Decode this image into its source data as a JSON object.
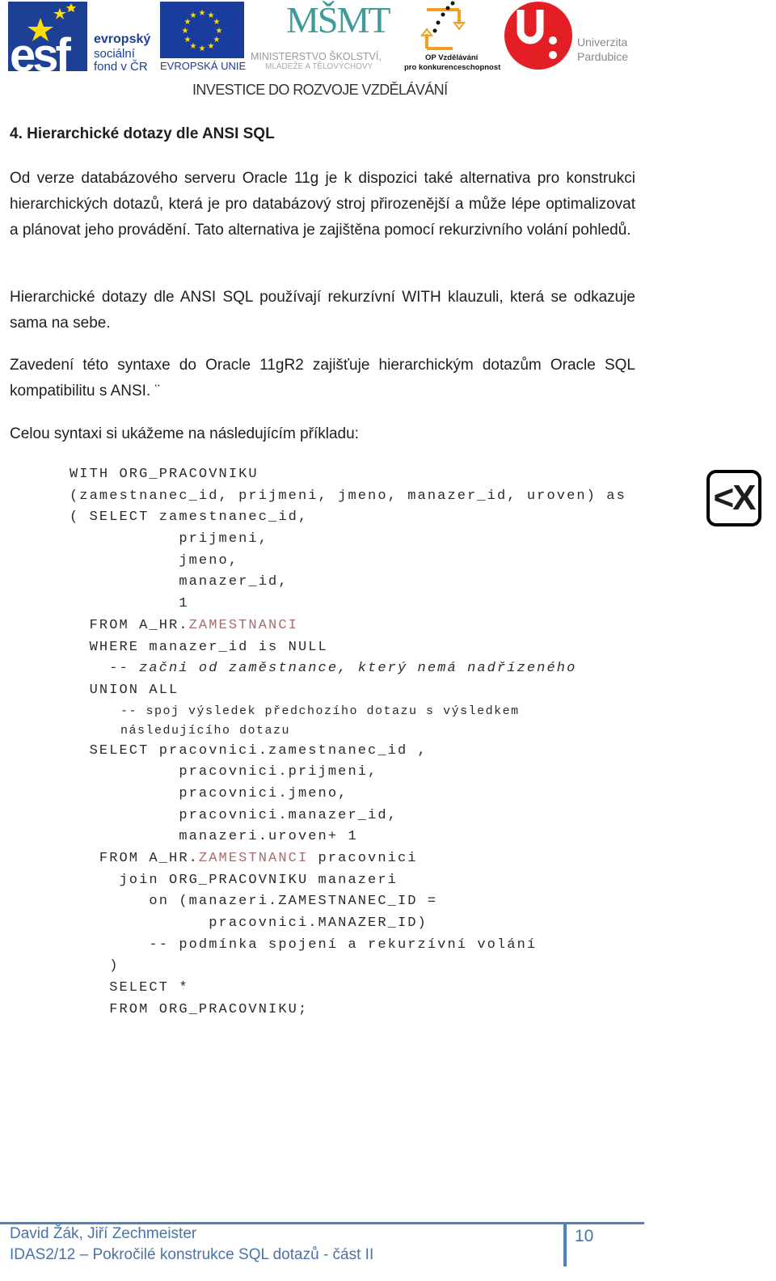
{
  "header": {
    "logos": {
      "esf": {
        "mark": "esf",
        "line1": "evropský",
        "line2": "sociální",
        "line3": "fond v ČR"
      },
      "eu": {
        "label": "EVROPSKÁ UNIE"
      },
      "msmt": {
        "mark": "MŠMT",
        "line1": "MINISTERSTVO ŠKOLSTVÍ,",
        "line2": "MLÁDEŽE A TĚLOVÝCHOVY"
      },
      "op": {
        "line1": "OP Vzdělávání",
        "line2": "pro konkurenceschopnost"
      },
      "upce": {
        "line1": "Univerzita",
        "line2": "Pardubice"
      }
    },
    "tagline": "INVESTICE DO ROZVOJE VZDĚLÁVÁNÍ",
    "colors": {
      "esf_blue": "#1d3f94",
      "eu_blue": "#1a3c9c",
      "eu_star": "#ffdd00",
      "msmt_teal": "#3f9a9a",
      "op_orange": "#f0a020",
      "upce_red": "#e31e24"
    }
  },
  "document": {
    "heading": "4. Hierarchické dotazy dle ANSI SQL",
    "paragraphs": [
      "Od verze databázového serveru Oracle 11g je k dispozici také alternativa pro konstrukci hierarchických dotazů, která je pro databázový stroj přirozenější a může lépe optimalizovat a plánovat jeho provádění. Tato alternativa je zajištěna pomocí rekurzivního volání pohledů.",
      "Hierarchické dotazy dle ANSI SQL používají rekurzívní WITH klauzuli, která se odkazuje sama na sebe.",
      "Zavedení této syntaxe do Oracle 11gR2 zajišťuje hierarchickým dotazům Oracle SQL kompatibilitu s ANSI. ¨",
      "Celou syntaxi si ukážeme na následujícím příkladu:"
    ],
    "code_lines": [
      {
        "text": "WITH ORG_PRACOVNIKU"
      },
      {
        "text": "(zamestnanec_id, prijmeni, jmeno, manazer_id, uroven) as"
      },
      {
        "text": "( SELECT zamestnanec_id,"
      },
      {
        "text": "           prijmeni,"
      },
      {
        "text": "           jmeno,"
      },
      {
        "text": "           manazer_id,"
      },
      {
        "text": "           1"
      },
      {
        "text": "  FROM A_HR.",
        "highlight": "ZAMESTNANCI"
      },
      {
        "text": "  WHERE manazer_id is NULL"
      },
      {
        "text": "    -- začni od zaměstnance, který nemá nadřízeného",
        "style": "italic"
      },
      {
        "text": "  UNION ALL"
      },
      {
        "text": "      -- spoj výsledek předchozího dotazu s výsledkem",
        "style": "small"
      },
      {
        "text": "      následujícího dotazu",
        "style": "small"
      },
      {
        "text": "  SELECT pracovnici.zamestnanec_id ,"
      },
      {
        "text": "           pracovnici.prijmeni,"
      },
      {
        "text": "           pracovnici.jmeno,"
      },
      {
        "text": "           pracovnici.manazer_id,"
      },
      {
        "text": "           manazeri.uroven+ 1"
      },
      {
        "text": "   FROM A_HR.",
        "highlight": "ZAMESTNANCI",
        "after": " pracovnici"
      },
      {
        "text": "     join ORG_PRACOVNIKU manazeri"
      },
      {
        "text": "        on (manazeri.ZAMESTNANEC_ID ="
      },
      {
        "text": "              pracovnici.MANAZER_ID)"
      },
      {
        "text": "        -- podmínka spojení a rekurzívní volání"
      },
      {
        "text": "    )"
      },
      {
        "text": "    SELECT *"
      },
      {
        "text": "    FROM ORG_PRACOVNIKU;"
      }
    ],
    "side_icon": {
      "name": "xml-close-icon",
      "glyph": "<X"
    },
    "highlight_color": "#a76c6c"
  },
  "footer": {
    "authors": "David Žák, Jiří Zechmeister",
    "course": "IDAS2/12 – Pokročilé konstrukce SQL dotazů - část II",
    "page_number": "10",
    "accent_color": "#4f81bd"
  }
}
